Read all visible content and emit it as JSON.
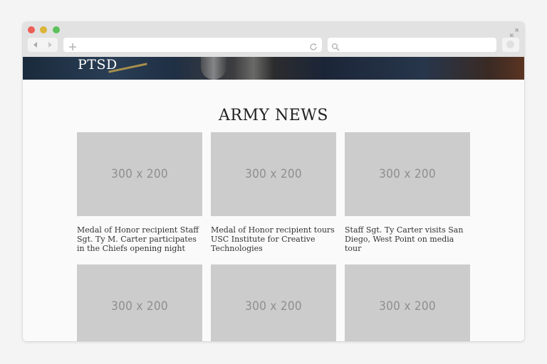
{
  "browser": {
    "icons": {
      "close": "close-dot",
      "minimize": "minimize-dot",
      "zoom": "zoom-dot",
      "back": "back-arrow-icon",
      "forward": "forward-arrow-icon",
      "new_tab": "plus-icon",
      "reload": "reload-icon",
      "search": "search-icon",
      "fullscreen": "expand-icon",
      "extension": "extension-icon"
    },
    "colors": {
      "close": "#ee5d56",
      "minimize": "#dbb43a",
      "zoom": "#5cc15c"
    },
    "address_value": "",
    "search_value": ""
  },
  "hero": {
    "title": "PTSD"
  },
  "news": {
    "heading": "ARMY NEWS",
    "items": [
      {
        "image_label": "300 x 200",
        "caption": "Medal of Honor recipient Staff Sgt. Ty M. Carter participates in the Chiefs opening night"
      },
      {
        "image_label": "300 x 200",
        "caption": "Medal of Honor recipient tours USC Institute for Creative Technologies"
      },
      {
        "image_label": "300 x 200",
        "caption": "Staff Sgt. Ty Carter visits San Diego, West Point on media tour"
      },
      {
        "image_label": "300 x 200",
        "caption": ""
      },
      {
        "image_label": "300 x 200",
        "caption": ""
      },
      {
        "image_label": "300 x 200",
        "caption": ""
      }
    ]
  }
}
